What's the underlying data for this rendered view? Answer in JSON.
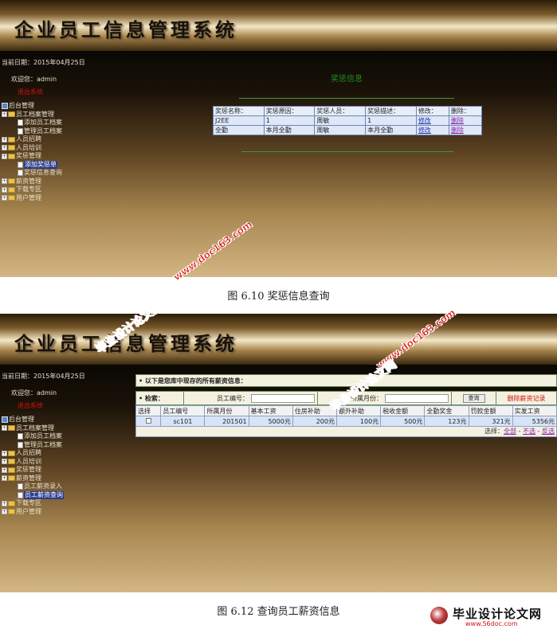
{
  "screen1": {
    "banner_title": "企业员工信息管理系统",
    "date_text": "当前日期：2015年04月25日",
    "welcome_text": "欢迎您：admin",
    "logout_text": "退出系统",
    "tree": [
      {
        "label": "后台管理",
        "depth": 1,
        "icon": "root-icon"
      },
      {
        "label": "员工档案管理",
        "depth": 1,
        "icon": "folder-icon"
      },
      {
        "label": "添加员工档案",
        "depth": 3,
        "icon": "page-icon"
      },
      {
        "label": "管理员工档案",
        "depth": 3,
        "icon": "page-icon"
      },
      {
        "label": "人员招聘",
        "depth": 1,
        "icon": "folder-icon"
      },
      {
        "label": "人员培训",
        "depth": 1,
        "icon": "folder-icon"
      },
      {
        "label": "奖惩管理",
        "depth": 1,
        "icon": "folder-icon"
      },
      {
        "label": "添加奖惩单",
        "depth": 3,
        "icon": "page-icon",
        "selected": true
      },
      {
        "label": "奖惩信息查询",
        "depth": 3,
        "icon": "page-icon"
      },
      {
        "label": "薪资管理",
        "depth": 1,
        "icon": "folder-icon"
      },
      {
        "label": "下载专区",
        "depth": 1,
        "icon": "folder-icon"
      },
      {
        "label": "用户管理",
        "depth": 1,
        "icon": "folder-icon"
      }
    ],
    "panel_title": "奖惩信息",
    "table": {
      "headers": [
        "奖惩名称：",
        "奖惩原因：",
        "奖惩人员：",
        "奖惩描述：",
        "修改：",
        "删除："
      ],
      "rows": [
        [
          "J2EE",
          "1",
          "周敏",
          "1",
          "修改",
          "删除"
        ],
        [
          "全勤",
          "本月全勤",
          "周敏",
          "本月全勤",
          "修改",
          "删除"
        ]
      ]
    },
    "caption": "图 6.10  奖惩信息查询"
  },
  "screen2": {
    "banner_title": "企业员工信息管理系统",
    "date_text": "当前日期：2015年04月25日",
    "welcome_text": "欢迎您：admin",
    "logout_text": "退出系统",
    "tree": [
      {
        "label": "后台管理",
        "depth": 1,
        "icon": "root-icon"
      },
      {
        "label": "员工档案管理",
        "depth": 1,
        "icon": "folder-icon"
      },
      {
        "label": "添加员工档案",
        "depth": 3,
        "icon": "page-icon"
      },
      {
        "label": "管理员工档案",
        "depth": 3,
        "icon": "page-icon"
      },
      {
        "label": "人员招聘",
        "depth": 1,
        "icon": "folder-icon"
      },
      {
        "label": "人员培训",
        "depth": 1,
        "icon": "folder-icon"
      },
      {
        "label": "奖惩管理",
        "depth": 1,
        "icon": "folder-icon"
      },
      {
        "label": "薪资管理",
        "depth": 1,
        "icon": "folder-icon"
      },
      {
        "label": "员工薪资录入",
        "depth": 3,
        "icon": "page-icon"
      },
      {
        "label": "员工薪资查询",
        "depth": 3,
        "icon": "page-icon",
        "selected": true
      },
      {
        "label": "下载专区",
        "depth": 1,
        "icon": "folder-icon"
      },
      {
        "label": "用户管理",
        "depth": 1,
        "icon": "folder-icon"
      }
    ],
    "info_text": "• 以下是您库中现存的所有薪资信息：",
    "search_label": "• 检索：",
    "employee_no_label": "员工编号：",
    "month_label": "所属月份：",
    "query_button": "查询",
    "delete_link": "删除薪资记录",
    "table": {
      "headers": [
        "选择",
        "员工编号",
        "所属月份",
        "基本工资",
        "住房补助",
        "额外补助",
        "税收金额",
        "全勤奖金",
        "罚款金额",
        "实发工资"
      ],
      "rows": [
        [
          "",
          "sc101",
          "201501",
          "5000元",
          "200元",
          "100元",
          "500元",
          "123元",
          "321元",
          "5356元"
        ]
      ]
    },
    "footer_select": "选择：",
    "select_all": "全部",
    "select_none": "不选",
    "select_invert": "反选",
    "caption": "图 6.12  查询员工薪资信息"
  },
  "watermarks": {
    "site_name": "毕业设计论文网",
    "url": "www.doc163.com"
  },
  "footer_logo": {
    "title": "毕业设计论文网",
    "url": "www.56doc.com"
  },
  "colors": {
    "accent_green": "#1e9020",
    "link_red": "#d81010",
    "table_blue": "#dfe8f6",
    "watermark_red": "#e01818"
  }
}
